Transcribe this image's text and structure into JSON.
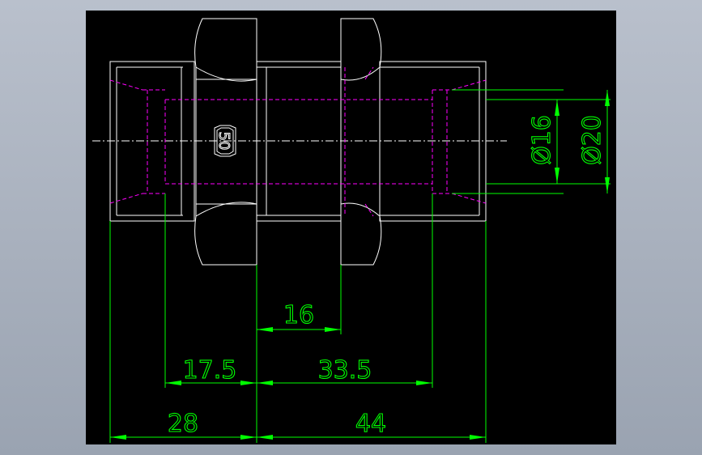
{
  "colors": {
    "background": "#a8b0bd",
    "canvas": "#000000",
    "outline": "#ffffff",
    "hidden_lines": "#ff00ff",
    "dimensions": "#00ff00"
  },
  "part_mark": "50",
  "dimensions": {
    "len_16": "16",
    "len_17_5": "17.5",
    "len_33_5": "33.5",
    "len_28": "28",
    "len_44": "44",
    "dia_16": "Ø16",
    "dia_20": "Ø20"
  }
}
